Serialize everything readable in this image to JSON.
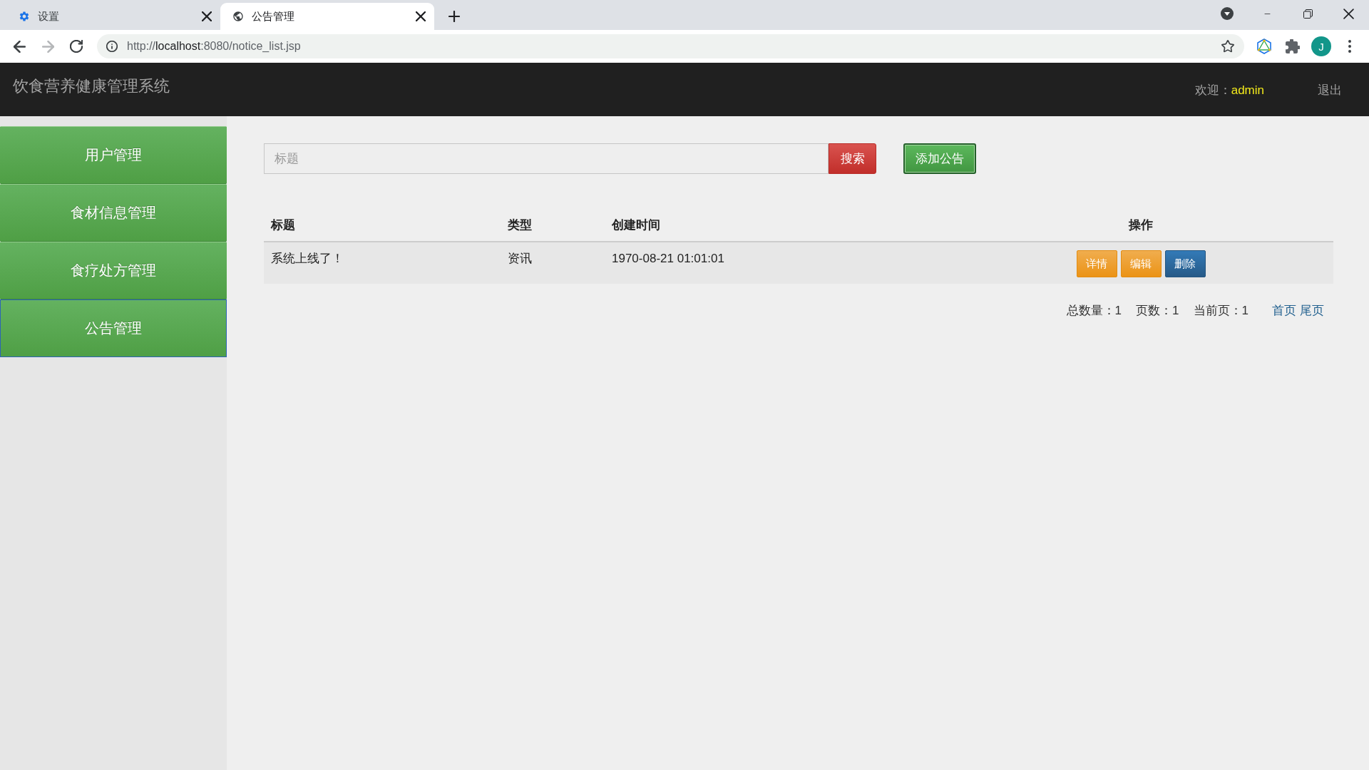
{
  "browser": {
    "tabs": [
      {
        "kind": "settings",
        "title": "设置",
        "selected": false
      },
      {
        "kind": "globe",
        "title": "公告管理",
        "selected": true
      }
    ],
    "url": {
      "scheme": "http://",
      "host": "localhost",
      "path": ":8080/notice_list.jsp"
    },
    "profile_initial": "J"
  },
  "header": {
    "title": "饮食营养健康管理系统",
    "welcome_label": "欢迎：",
    "user": "admin",
    "logout": "退出"
  },
  "sidebar": {
    "items": [
      {
        "label": "用户管理",
        "selected": false
      },
      {
        "label": "食材信息管理",
        "selected": false
      },
      {
        "label": "食疗处方管理",
        "selected": false
      },
      {
        "label": "公告管理",
        "selected": true
      }
    ]
  },
  "search": {
    "placeholder": "标题",
    "button": "搜索"
  },
  "add_button": {
    "label": "添加公告",
    "focused": true
  },
  "table": {
    "columns": [
      "标题",
      "类型",
      "创建时间",
      "操作"
    ],
    "rows": [
      {
        "cells": [
          "系统上线了！",
          "资讯",
          "1970-08-21 01:01:01"
        ],
        "actions": [
          {
            "label": "详情",
            "kind": "warning"
          },
          {
            "label": "编辑",
            "kind": "warning"
          },
          {
            "label": "删除",
            "kind": "primary"
          }
        ]
      }
    ]
  },
  "pagination": {
    "stats": [
      "总数量：1",
      "页数：1",
      "当前页：1"
    ],
    "links": [
      "首页",
      "尾页"
    ]
  }
}
